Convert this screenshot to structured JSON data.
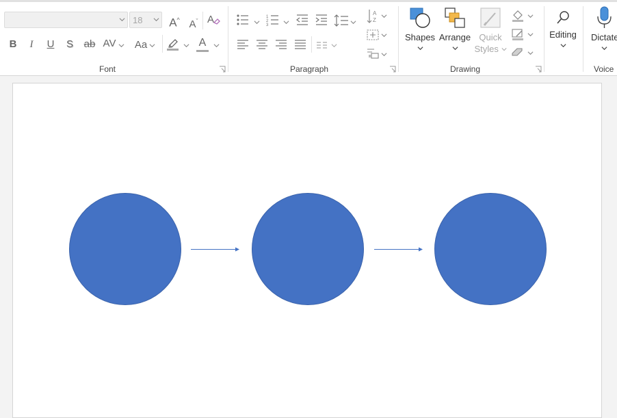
{
  "ribbon": {
    "font_group": {
      "label": "Font",
      "font_name_value": "",
      "font_size_value": "18",
      "grow_label": "A",
      "shrink_label": "A",
      "bold": "B",
      "italic": "I",
      "underline": "U",
      "shadow": "S",
      "strike": "ab",
      "spacing": "AV",
      "case": "Aa",
      "font_color": "A"
    },
    "paragraph_group": {
      "label": "Paragraph"
    },
    "drawing_group": {
      "label": "Drawing",
      "shapes_label": "Shapes",
      "arrange_label": "Arrange",
      "quick_styles_line1": "Quick",
      "quick_styles_line2": "Styles"
    },
    "editing_label": "Editing",
    "voice_group": {
      "label": "Voice",
      "dictate_label": "Dictate"
    }
  },
  "colors": {
    "shape_fill": "#4472c4",
    "arrow": "#4472c4",
    "ribbon_bg": "#ffffff",
    "workspace_bg": "#f3f3f3"
  },
  "canvas": {
    "shapes": [
      {
        "type": "circle",
        "name": "circle-1"
      },
      {
        "type": "arrow",
        "name": "arrow-1"
      },
      {
        "type": "circle",
        "name": "circle-2"
      },
      {
        "type": "arrow",
        "name": "arrow-2"
      },
      {
        "type": "circle",
        "name": "circle-3"
      }
    ]
  }
}
